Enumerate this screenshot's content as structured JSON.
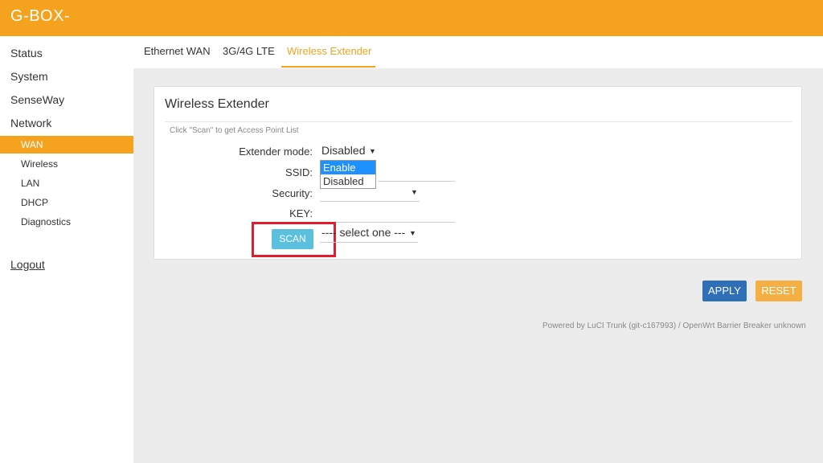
{
  "header": {
    "brand": "G-BOX-",
    "color": "#f5a31f"
  },
  "sidebar": {
    "items": [
      {
        "label": "Status"
      },
      {
        "label": "System"
      },
      {
        "label": "SenseWay"
      },
      {
        "label": "Network"
      }
    ],
    "subitems": [
      {
        "label": "WAN",
        "active": true
      },
      {
        "label": "Wireless"
      },
      {
        "label": "LAN"
      },
      {
        "label": "DHCP"
      },
      {
        "label": "Diagnostics"
      }
    ],
    "logout": "Logout"
  },
  "tabs": [
    {
      "label": "Ethernet WAN"
    },
    {
      "label": "3G/4G LTE"
    },
    {
      "label": "Wireless Extender",
      "active": true
    }
  ],
  "panel": {
    "title": "Wireless Extender",
    "hint": "Click \"Scan\" to get Access Point List",
    "extender_mode": {
      "label": "Extender mode:",
      "value": "Disabled",
      "options": [
        "Enable",
        "Disabled"
      ],
      "highlighted": "Enable"
    },
    "ssid": {
      "label": "SSID:",
      "value": ""
    },
    "security": {
      "label": "Security:",
      "value": ""
    },
    "key": {
      "label": "KEY:",
      "value": ""
    },
    "scan_button": "SCAN",
    "ap_select": {
      "value": "---- select one ---"
    }
  },
  "actions": {
    "apply": "APPLY",
    "reset": "RESET"
  },
  "footer": "Powered by LuCI Trunk (git-c167993) / OpenWrt Barrier Breaker unknown",
  "colors": {
    "accent": "#f5a31f",
    "apply": "#2e6fb7",
    "reset": "#f5b045",
    "scan": "#5bc0de",
    "highlight_box": "#e11c2c"
  }
}
